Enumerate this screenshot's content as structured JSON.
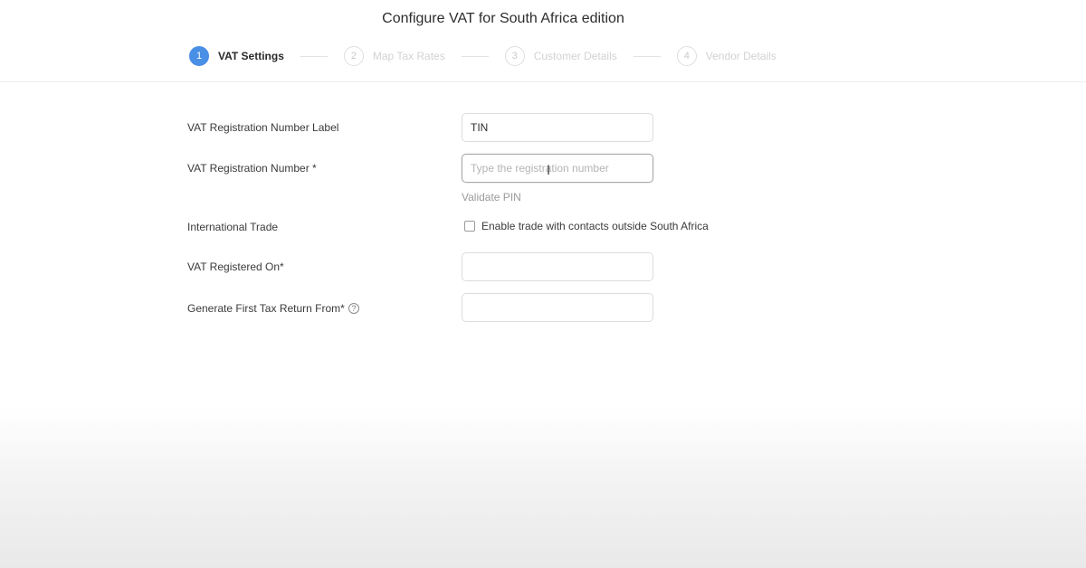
{
  "page": {
    "title": "Configure VAT for South Africa edition"
  },
  "stepper": {
    "steps": [
      {
        "number": "1",
        "label": "VAT Settings",
        "active": true
      },
      {
        "number": "2",
        "label": "Map Tax Rates",
        "active": false
      },
      {
        "number": "3",
        "label": "Customer Details",
        "active": false
      },
      {
        "number": "4",
        "label": "Vendor Details",
        "active": false
      }
    ]
  },
  "form": {
    "reg_label": {
      "label": "VAT Registration Number Label",
      "value": "TIN"
    },
    "reg_number": {
      "label": "VAT Registration Number *",
      "placeholder": "Type the registration number",
      "value": ""
    },
    "validate_link": "Validate PIN",
    "international_trade": {
      "label": "International Trade",
      "checkbox_label": "Enable trade with contacts outside South Africa",
      "checked": false
    },
    "registered_on": {
      "label": "VAT Registered On*",
      "value": ""
    },
    "first_return": {
      "label": "Generate First Tax Return From*",
      "help_icon": "?",
      "value": ""
    }
  },
  "colors": {
    "active_step": "#4a8fe6",
    "inactive_step_text": "#d2d2d2"
  },
  "icons": {
    "help": "question-circle-icon",
    "text_cursor": "i-beam-cursor-icon"
  }
}
